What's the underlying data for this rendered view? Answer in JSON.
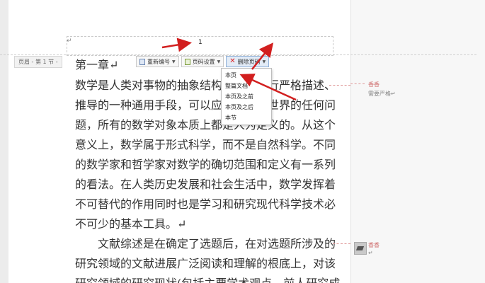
{
  "header": {
    "page_number": "1",
    "tag_label": "页眉 - 第 1 节 -",
    "pilcrow": "↵"
  },
  "toolbar": {
    "renumber_label": "重新编号",
    "page_number_settings_label": "页码设置",
    "delete_page_number_label": "删除页码"
  },
  "dropdown": {
    "items": [
      "本页",
      "整篇文档",
      "本页及之前",
      "本页及之后",
      "本节"
    ]
  },
  "body": {
    "lines": [
      "第一章↵",
      "数学是人类对事物的抽象结构与模式进行严格描述、",
      "推导的一种通用手段，可以应用于现实世界的任何问",
      "题，所有的数学对象本质上都是人为定义的。从这个",
      "意义上，数学属于形式科学，而不是自然科学。不同",
      "的数学家和哲学家对数学的确切范围和定义有一系列",
      "的看法。在人类历史发展和社会生活中，数学发挥着",
      "不可替代的作用同时也是学习和研究现代科学技术必",
      "不可少的基本工具。↵",
      "文献综述是在确定了选题后，在对选题所涉及的",
      "研究领域的文献进展广泛阅读和理解的根底上，对该",
      "研究领域的研究现状(包括主要学术观点、前人研究成"
    ]
  },
  "comments": [
    {
      "author": "香香",
      "text": "需要严格↵"
    },
    {
      "author": "香香",
      "text": "↵"
    }
  ],
  "colors": {
    "arrow": "#d21f1f",
    "comment": "#d07070"
  }
}
